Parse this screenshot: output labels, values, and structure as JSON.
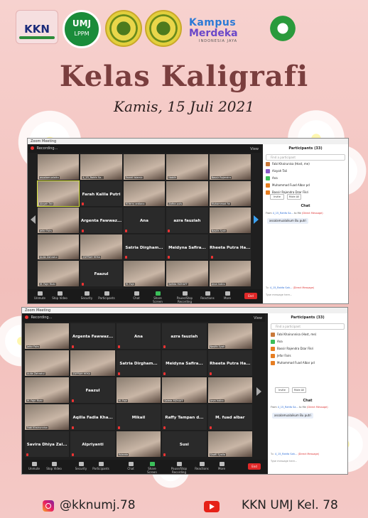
{
  "logos": {
    "kkn_logo": "KKN",
    "umj_logo": "UMJ",
    "lppm_logo": "LPPM",
    "kampus_merdeka_1": "Kampus",
    "kampus_merdeka_2": "Merdeka",
    "kampus_merdeka_3": "INDONESIA JAYA"
  },
  "title": "Kelas Kaligrafi",
  "subtitle": "Kamis, 15 Juli 2021",
  "zoom1": {
    "window_title": "Zoom Meeting",
    "recording": "Recording...",
    "view_label": "View",
    "tiles": [
      {
        "name": "",
        "label": "assalamualaiku",
        "cam": true
      },
      {
        "name": "",
        "label": "4_15_Rahfa Sa...",
        "cam": true
      },
      {
        "name": "",
        "label": "Farrell Islamic",
        "cam": true
      },
      {
        "name": "",
        "label": "Nabilh",
        "cam": true
      },
      {
        "name": "",
        "label": "Bassir Rajendra",
        "cam": true
      },
      {
        "name": "",
        "label": "Aisyah Tali",
        "cam": true,
        "sel": true
      },
      {
        "name": "Farah Kalila Putri",
        "label": "",
        "cam": false
      },
      {
        "name": "",
        "label": "M ferry ardiana",
        "cam": true
      },
      {
        "name": "",
        "label": "Zafira puts",
        "cam": true
      },
      {
        "name": "",
        "label": "Muhammad Fal",
        "cam": true
      },
      {
        "name": "",
        "label": "Jefar Fairs",
        "cam": true
      },
      {
        "name": "Argenta Fawwaz...",
        "label": "",
        "cam": false
      },
      {
        "name": "Ana",
        "label": "",
        "cam": false
      },
      {
        "name": "azra fauziah",
        "label": "",
        "cam": false
      },
      {
        "name": "",
        "label": "Nasifa Syah",
        "cam": true
      },
      {
        "name": "",
        "label": "Aulia Zahrotul",
        "cam": true
      },
      {
        "name": "",
        "label": "ZUFRAH HEKA",
        "cam": true
      },
      {
        "name": "Satria Dirgham...",
        "label": "",
        "cam": false
      },
      {
        "name": "Meidyna Safira...",
        "label": "",
        "cam": false
      },
      {
        "name": "Rheeta Putra Ha...",
        "label": "",
        "cam": false
      },
      {
        "name": "",
        "label": "M. Fajri Rizki",
        "cam": true
      },
      {
        "name": "Faazul",
        "label": "",
        "cam": false
      },
      {
        "name": "",
        "label": "M. Fajri",
        "cam": true
      },
      {
        "name": "",
        "label": "Safeta MZHAFF",
        "cam": true
      },
      {
        "name": "",
        "label": "Arva Indiro",
        "cam": true
      }
    ],
    "toolbar": [
      "Unmute",
      "Stop Video",
      "Security",
      "Participants",
      "Chat",
      "Share Screen",
      "Pause/Stop Recording",
      "Reactions",
      "More"
    ],
    "end": "End",
    "participants_title": "Participants (33)",
    "search_placeholder": "Find a participant",
    "participants": [
      {
        "name": "Fabi Khairunisa (Host, me)",
        "color": "#c9793a"
      },
      {
        "name": "Aisyah Tali",
        "color": "#8b5cc9"
      },
      {
        "name": "Ana",
        "color": "#3bbf5a"
      },
      {
        "name": "Muhammad Fuad Albar pd",
        "color": "#e67e22"
      },
      {
        "name": "Bassir Rajendra Dzar Fikri",
        "color": "#e67e22"
      }
    ],
    "invite": "Invite",
    "mute_all": "Mute All",
    "chat_title": "Chat",
    "chat_from": "From",
    "chat_sender": "4_15_Rahfa Sa...",
    "chat_to": "to Me",
    "chat_direct": "(Direct Message)",
    "chat_message": "assalamualaikum Bu putri",
    "chat_input_to": "To:",
    "chat_input_name": "4_15_Rahfa Sah...",
    "chat_input_direct": "(Direct Message)",
    "chat_input_placeholder": "Type message here..."
  },
  "zoom2": {
    "window_title": "Zoom Meeting",
    "recording": "Recording...",
    "view_label": "View",
    "tiles": [
      {
        "name": "",
        "label": "Jefar Fairs",
        "cam": true
      },
      {
        "name": "Argenta Fawwaz...",
        "label": "",
        "cam": false
      },
      {
        "name": "Ana",
        "label": "",
        "cam": false
      },
      {
        "name": "azra fauziah",
        "label": "",
        "cam": false
      },
      {
        "name": "",
        "label": "Nasifa Syah",
        "cam": true
      },
      {
        "name": "",
        "label": "Aulia Zahrotul",
        "cam": true
      },
      {
        "name": "",
        "label": "ZUFRAH HEKA",
        "cam": true
      },
      {
        "name": "Satria Dirgham...",
        "label": "",
        "cam": false
      },
      {
        "name": "Meidyna Safira...",
        "label": "",
        "cam": false
      },
      {
        "name": "Rheeta Putra Ha...",
        "label": "",
        "cam": false
      },
      {
        "name": "",
        "label": "M. Fajri Rizki",
        "cam": true
      },
      {
        "name": "Faazul",
        "label": "",
        "cam": false
      },
      {
        "name": "",
        "label": "M. Fajri",
        "cam": true
      },
      {
        "name": "",
        "label": "Safeta MZHAFF",
        "cam": true
      },
      {
        "name": "",
        "label": "Arva Indiro",
        "cam": true
      },
      {
        "name": "",
        "label": "Fabi Khairunnisa",
        "cam": true
      },
      {
        "name": "Aqilla Fadia Kha...",
        "label": "",
        "cam": false
      },
      {
        "name": "Mikail",
        "label": "",
        "cam": false
      },
      {
        "name": "Raffy Tampan d...",
        "label": "",
        "cam": false
      },
      {
        "name": "M. fuad albar",
        "label": "",
        "cam": false
      },
      {
        "name": "Savira Dhiya Zai...",
        "label": "",
        "cam": false
      },
      {
        "name": "Alpriyanti",
        "label": "",
        "cam": false
      },
      {
        "name": "",
        "label": "Yolanda",
        "cam": true
      },
      {
        "name": "Susi",
        "label": "",
        "cam": false
      },
      {
        "name": "",
        "label": "Shafil Syalla",
        "cam": true
      }
    ],
    "toolbar": [
      "Unmute",
      "Stop Video",
      "Security",
      "Participants",
      "Chat",
      "Share Screen",
      "Pause/Stop Recording",
      "Reactions",
      "More"
    ],
    "end": "End",
    "participants_title": "Participants (33)",
    "search_placeholder": "Find a participant",
    "participants": [
      {
        "name": "Fabi Khairunnisa (Host, me)",
        "color": "#c9793a"
      },
      {
        "name": "Ana",
        "color": "#3bbf5a"
      },
      {
        "name": "Bassir Rajendra Dzar Fikri",
        "color": "#e67e22"
      },
      {
        "name": "Jefar Fairs",
        "color": "#e67e22"
      },
      {
        "name": "Muhammad Fuad Albar pd",
        "color": "#e67e22"
      }
    ],
    "invite": "Invite",
    "mute_all": "Mute All",
    "chat_title": "Chat",
    "chat_from": "From",
    "chat_sender": "4_15_Rahfa Sa...",
    "chat_to": "to Me",
    "chat_direct": "(Direct Message)",
    "chat_message": "assalamualaikum Bu putri",
    "chat_input_to": "To:",
    "chat_input_name": "4_15_Rahfa Sah...",
    "chat_input_direct": "(Direct Message)",
    "chat_input_placeholder": "Type message here..."
  },
  "footer": {
    "instagram": "@kknumj.78",
    "youtube": "KKN UMJ Kel. 78"
  }
}
